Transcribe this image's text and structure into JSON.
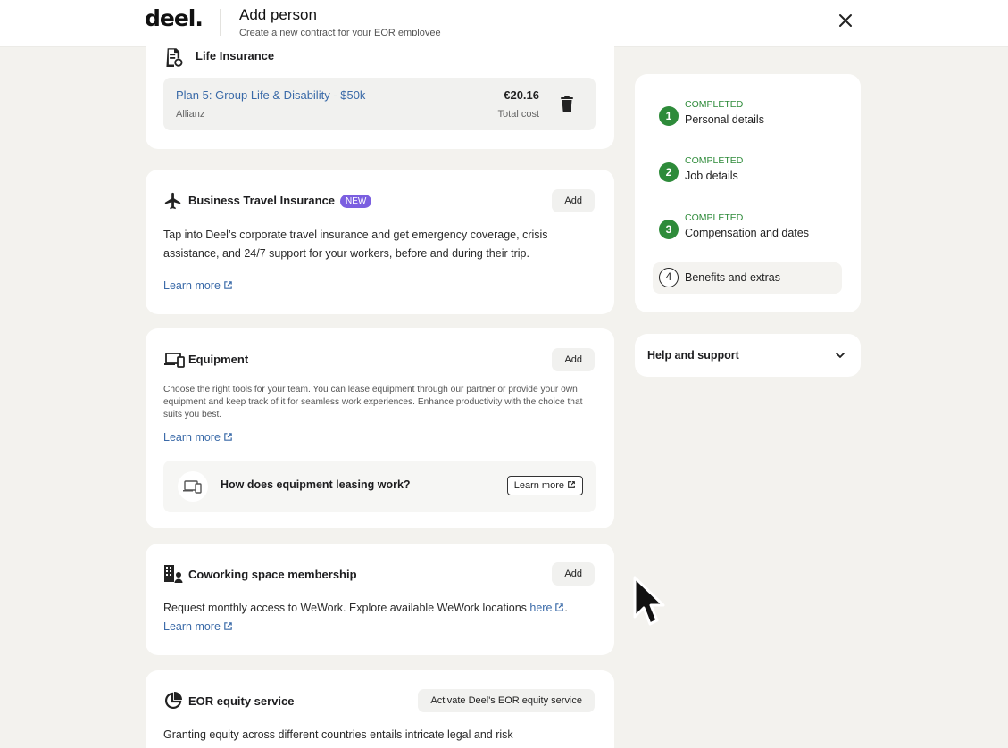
{
  "header": {
    "logo": "deel.",
    "title": "Add person",
    "subtitle": "Create a new contract for your EOR employee",
    "close_icon": "close-icon"
  },
  "life_insurance": {
    "title": "Life Insurance",
    "icon": "document-icon",
    "plan_name": "Plan 5: Group Life & Disability - $50k",
    "provider": "Allianz",
    "price": "€20.16",
    "price_label": "Total cost",
    "delete_icon": "trash-icon"
  },
  "travel_insurance": {
    "title": "Business Travel Insurance",
    "badge": "NEW",
    "icon": "airplane-icon",
    "add_label": "Add",
    "description": "Tap into Deel’s corporate travel insurance and get emergency coverage, crisis assistance, and 24/7 support for your workers, before and during their trip.",
    "learn_more": "Learn more"
  },
  "equipment": {
    "title": "Equipment",
    "icon": "devices-icon",
    "add_label": "Add",
    "description": "Choose the right tools for your team. You can lease equipment through our partner or provide your own equipment and keep track of it for seamless work experiences. Enhance productivity with the choice that suits you best.",
    "learn_more": "Learn more",
    "leasing_question": "How does equipment leasing work?",
    "leasing_button": "Learn more"
  },
  "coworking": {
    "title": "Coworking space membership",
    "icon": "building-person-icon",
    "add_label": "Add",
    "description": "Request monthly access to WeWork. Explore available WeWork locations",
    "here_link": "here",
    "period": ".",
    "learn_more": "Learn more"
  },
  "equity": {
    "title": "EOR equity service",
    "icon": "pie-chart-icon",
    "activate_label": "Activate Deel's EOR equity service",
    "description": "Granting equity across different countries entails intricate legal and risk"
  },
  "steps": [
    {
      "number": "1",
      "status": "COMPLETED",
      "label": "Personal details"
    },
    {
      "number": "2",
      "status": "COMPLETED",
      "label": "Job details"
    },
    {
      "number": "3",
      "status": "COMPLETED",
      "label": "Compensation and dates"
    },
    {
      "number": "4",
      "status": "",
      "label": "Benefits and extras"
    }
  ],
  "help": {
    "label": "Help and support",
    "chevron_icon": "chevron-down-icon"
  },
  "colors": {
    "accent_link": "#3a6aa8",
    "completed_green": "#2e8b3a",
    "badge_purple": "#7b5fe0",
    "background": "#f3f2ee"
  }
}
